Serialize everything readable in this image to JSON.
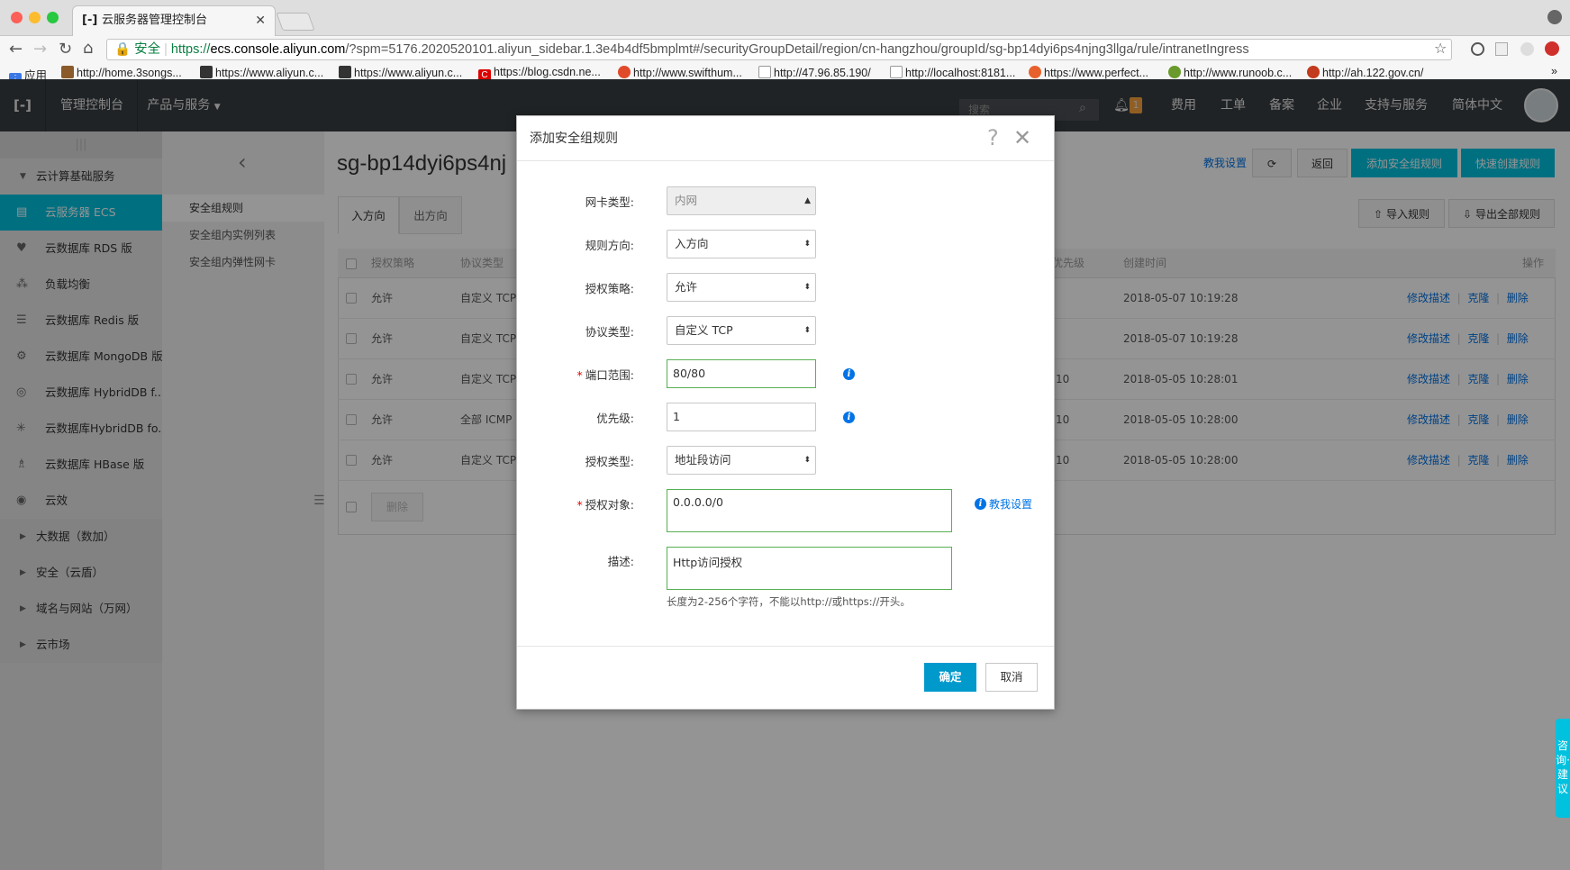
{
  "browser": {
    "tab_title": "云服务器管理控制台",
    "secure_label": "安全",
    "url_proto": "https://",
    "url_host": "ecs.console.aliyun.com",
    "url_path": "/?spm=5176.2020520101.aliyun_sidebar.1.3e4b4df5bmplmt#/securityGroupDetail/region/cn-hangzhou/groupId/sg-bp14dyi6ps4njng3llga/rule/intranetIngress",
    "bookmarks": [
      "应用",
      "http://home.3songs...",
      "https://www.aliyun.c...",
      "https://www.aliyun.c...",
      "https://blog.csdn.ne...",
      "http://www.swifthum...",
      "http://47.96.85.190/",
      "http://localhost:8181...",
      "https://www.perfect...",
      "http://www.runoob.c...",
      "http://ah.122.gov.cn/"
    ]
  },
  "header": {
    "console": "管理控制台",
    "products": "产品与服务",
    "search_placeholder": "搜索",
    "bell_count": "1",
    "items": [
      "费用",
      "工单",
      "备案",
      "企业",
      "支持与服务",
      "简体中文"
    ]
  },
  "sidebar": {
    "handle": "|||",
    "items": [
      {
        "label": "云计算基础服务",
        "icon": "caret-down-icon"
      },
      {
        "label": "云服务器 ECS",
        "icon": "ecs-icon"
      },
      {
        "label": "云数据库 RDS 版",
        "icon": "rds-icon"
      },
      {
        "label": "负载均衡",
        "icon": "slb-icon"
      },
      {
        "label": "云数据库 Redis 版",
        "icon": "redis-icon"
      },
      {
        "label": "云数据库 MongoDB 版",
        "icon": "mongodb-icon"
      },
      {
        "label": "云数据库 HybridDB f...",
        "icon": "hybriddb-icon"
      },
      {
        "label": "云数据库HybridDB fo...",
        "icon": "hybriddb2-icon"
      },
      {
        "label": "云数据库 HBase 版",
        "icon": "hbase-icon"
      },
      {
        "label": "云效",
        "icon": "yunxiao-icon"
      },
      {
        "label": "大数据（数加）",
        "icon": "caret-right-icon"
      },
      {
        "label": "安全（云盾）",
        "icon": "caret-right-icon"
      },
      {
        "label": "域名与网站（万网）",
        "icon": "caret-right-icon"
      },
      {
        "label": "云市场",
        "icon": "caret-right-icon"
      }
    ]
  },
  "subnav": {
    "items": [
      "安全组规则",
      "安全组内实例列表",
      "安全组内弹性网卡"
    ]
  },
  "main": {
    "title": "sg-bp14dyi6ps4nj",
    "teach": "教我设置",
    "refresh": "⟳",
    "back": "返回",
    "add_rule": "添加安全组规则",
    "quick_rule": "快速创建规则",
    "tabs": [
      "入方向",
      "出方向"
    ],
    "import": "导入规则",
    "export": "导出全部规则",
    "columns": [
      "授权策略",
      "协议类型",
      "优先级",
      "创建时间",
      "操作"
    ],
    "rows": [
      {
        "policy": "允许",
        "proto": "自定义 TCP",
        "prio": "",
        "time": "2018-05-07 10:19:28"
      },
      {
        "policy": "允许",
        "proto": "自定义 TCP",
        "prio": "",
        "time": "2018-05-07 10:19:28"
      },
      {
        "policy": "允许",
        "proto": "自定义 TCP",
        "prio": "10",
        "time": "2018-05-05 10:28:01"
      },
      {
        "policy": "允许",
        "proto": "全部 ICMP",
        "prio": "10",
        "time": "2018-05-05 10:28:00"
      },
      {
        "policy": "允许",
        "proto": "自定义 TCP",
        "prio": "10",
        "time": "2018-05-05 10:28:00"
      }
    ],
    "actions": [
      "修改描述",
      "克隆",
      "删除"
    ],
    "delete_btn": "删除"
  },
  "dialog": {
    "title": "添加安全组规则",
    "fields": {
      "nic_label": "网卡类型:",
      "nic_value": "内网",
      "dir_label": "规则方向:",
      "dir_value": "入方向",
      "policy_label": "授权策略:",
      "policy_value": "允许",
      "proto_label": "协议类型:",
      "proto_value": "自定义 TCP",
      "port_label": "端口范围:",
      "port_value": "80/80",
      "prio_label": "优先级:",
      "prio_value": "1",
      "authtype_label": "授权类型:",
      "authtype_value": "地址段访问",
      "target_label": "授权对象:",
      "target_value": "0.0.0.0/0",
      "teach": "教我设置",
      "desc_label": "描述:",
      "desc_value": "Http访问授权",
      "desc_hint": "长度为2-256个字符，不能以http://或https://开头。"
    },
    "ok": "确定",
    "cancel": "取消"
  },
  "feedback": "咨询·建议"
}
